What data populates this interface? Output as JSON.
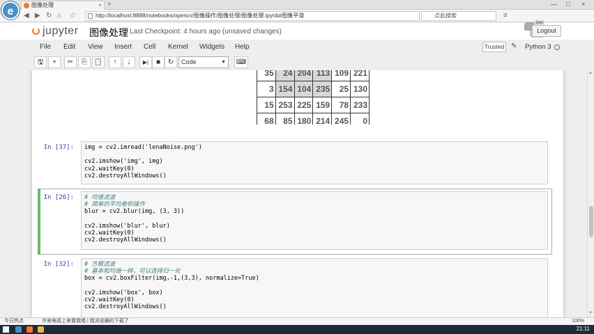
{
  "browser": {
    "tab_title": "图像处理",
    "url": "http://localhost:8888/notebooks/opencv/图像操作/图像处理/图像处理.ipynb#图像平滑",
    "search_placeholder": "点此搜索",
    "logo_letter": "e",
    "new_tab": "+",
    "tab_close": "×",
    "nav": {
      "back": "◀",
      "forward": "▶",
      "refresh": "↻",
      "home": "⌂",
      "star": "☆",
      "menu": "≡"
    },
    "window_controls": {
      "minimize": "—",
      "maximize": "□",
      "close": "×"
    }
  },
  "header": {
    "logo_text": "jupyter",
    "notebook_name": "图像处理",
    "checkpoint": "Last Checkpoint: 4 hours ago (unsaved changes)",
    "logout": "Logout",
    "python_badge": "3ieit"
  },
  "menubar": {
    "items": [
      "File",
      "Edit",
      "View",
      "Insert",
      "Cell",
      "Kernel",
      "Widgets",
      "Help"
    ],
    "trusted": "Trusted",
    "kernel_name": "Python 3"
  },
  "toolbar": {
    "save": "🖫",
    "add": "+",
    "cut": "✂",
    "copy": "⎘",
    "paste": "📋",
    "up": "↑",
    "down": "↓",
    "run": "▶|",
    "stop": "■",
    "restart": "↻",
    "fastforward": "⏩",
    "cell_type": "Code",
    "keyboard": "⌨"
  },
  "matrix": {
    "rows": [
      [
        "35",
        "24",
        "204",
        "113",
        "109",
        "221"
      ],
      [
        "3",
        "154",
        "104",
        "235",
        "25",
        "130"
      ],
      [
        "15",
        "253",
        "225",
        "159",
        "78",
        "233"
      ],
      [
        "68",
        "85",
        "180",
        "214",
        "245",
        "0"
      ]
    ]
  },
  "cells": [
    {
      "prompt": "In [37]:",
      "lines": [
        "img = cv2.imread('lenaNoise.png')",
        "",
        "cv2.imshow('img', img)",
        "cv2.waitKey(0)",
        "cv2.destroyAllWindows()"
      ]
    },
    {
      "prompt": "In [26]:",
      "lines": [
        "# 均值滤波",
        "# 简单的平均卷积操作",
        "blur = cv2.blur(img, (3, 3))",
        "",
        "cv2.imshow('blur', blur)",
        "cv2.waitKey(0)",
        "cv2.destroyAllWindows()"
      ]
    },
    {
      "prompt": "In [32]:",
      "lines": [
        "# 方框滤波",
        "# 基本和均值一样，可以选择归一化",
        "box = cv2.boxFilter(img,-1,(3,3), normalize=True)",
        "",
        "cv2.imshow('box', box)",
        "cv2.waitKey(0)",
        "cv2.destroyAllWindows()"
      ]
    }
  ],
  "statusbar": {
    "left": "今日热点",
    "middle": "许嵩电视上来看我唱 | 我浏览器的下载了",
    "right": "100%"
  },
  "taskbar": {
    "clock": "21:11"
  },
  "colors": {
    "prompt": "#303f9f",
    "selected": "#66bb6a",
    "jupyter_orange": "#f37726",
    "comment": "#408080",
    "string": "#ba2121"
  }
}
